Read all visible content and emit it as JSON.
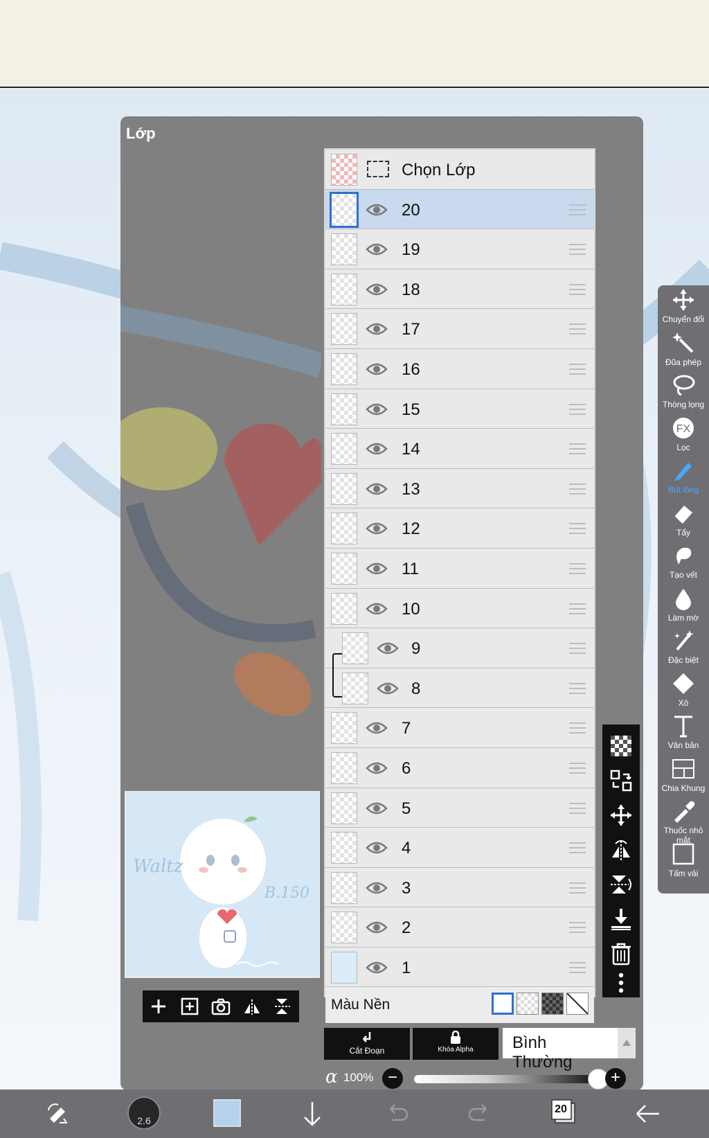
{
  "dialog": {
    "title": "Lớp"
  },
  "layers": {
    "select_row_label": "Chọn Lớp",
    "items": [
      {
        "name": "20",
        "selected": true,
        "clipped": false,
        "thumb": "checker"
      },
      {
        "name": "19",
        "selected": false,
        "clipped": false,
        "thumb": "checker"
      },
      {
        "name": "18",
        "selected": false,
        "clipped": false,
        "thumb": "checker"
      },
      {
        "name": "17",
        "selected": false,
        "clipped": false,
        "thumb": "checker"
      },
      {
        "name": "16",
        "selected": false,
        "clipped": false,
        "thumb": "checker"
      },
      {
        "name": "15",
        "selected": false,
        "clipped": false,
        "thumb": "checker"
      },
      {
        "name": "14",
        "selected": false,
        "clipped": false,
        "thumb": "checker"
      },
      {
        "name": "13",
        "selected": false,
        "clipped": false,
        "thumb": "checker"
      },
      {
        "name": "12",
        "selected": false,
        "clipped": false,
        "thumb": "checker"
      },
      {
        "name": "11",
        "selected": false,
        "clipped": false,
        "thumb": "checker"
      },
      {
        "name": "10",
        "selected": false,
        "clipped": false,
        "thumb": "checker"
      },
      {
        "name": "9",
        "selected": false,
        "clipped": true,
        "thumb": "checker"
      },
      {
        "name": "8",
        "selected": false,
        "clipped": true,
        "thumb": "checker"
      },
      {
        "name": "7",
        "selected": false,
        "clipped": false,
        "thumb": "checker"
      },
      {
        "name": "6",
        "selected": false,
        "clipped": false,
        "thumb": "checker"
      },
      {
        "name": "5",
        "selected": false,
        "clipped": false,
        "thumb": "checker"
      },
      {
        "name": "4",
        "selected": false,
        "clipped": false,
        "thumb": "checker"
      },
      {
        "name": "3",
        "selected": false,
        "clipped": false,
        "thumb": "checker"
      },
      {
        "name": "2",
        "selected": false,
        "clipped": false,
        "thumb": "checker"
      },
      {
        "name": "1",
        "selected": false,
        "clipped": false,
        "thumb": "blue"
      }
    ],
    "background_label": "Màu Nền"
  },
  "controls": {
    "clipping_label": "Cắt Đoạn",
    "alpha_lock_label": "Khóa Alpha",
    "blend_mode": "Bình Thường",
    "opacity_symbol": "α",
    "opacity_value": "100%",
    "opacity_fraction": 1.0
  },
  "right_toolbar": [
    {
      "label": "Chuyển đổi",
      "icon": "move-icon",
      "active": false
    },
    {
      "label": "Đũa phép",
      "icon": "magic-wand-icon",
      "active": false
    },
    {
      "label": "Thòng lọng",
      "icon": "lasso-icon",
      "active": false
    },
    {
      "label": "Lọc",
      "icon": "fx-icon",
      "active": false
    },
    {
      "label": "Bút lông",
      "icon": "brush-icon",
      "active": true
    },
    {
      "label": "Tẩy",
      "icon": "eraser-icon",
      "active": false
    },
    {
      "label": "Tạo vết",
      "icon": "smudge-icon",
      "active": false
    },
    {
      "label": "Làm mờ",
      "icon": "blur-icon",
      "active": false
    },
    {
      "label": "Đặc biệt",
      "icon": "special-icon",
      "active": false
    },
    {
      "label": "Xô",
      "icon": "bucket-icon",
      "active": false
    },
    {
      "label": "Văn bản",
      "icon": "text-icon",
      "active": false
    },
    {
      "label": "Chia Khung",
      "icon": "frame-divider-icon",
      "active": false
    },
    {
      "label": "Thuốc nhỏ mắt",
      "icon": "eyedropper-icon",
      "active": false
    },
    {
      "label": "Tấm vải",
      "icon": "canvas-icon",
      "active": false
    }
  ],
  "preview": {
    "text_left": "Waltz",
    "text_right": "B.150"
  },
  "bottom_bar": {
    "brush_size": "2.6",
    "layer_count": "20",
    "color": "#b5d2ec"
  },
  "colors": {
    "dialog_bg": "#808080",
    "selected_row": "#c9d9ee",
    "accent": "#2f6fd0",
    "toolbar": "#6f6f73"
  }
}
